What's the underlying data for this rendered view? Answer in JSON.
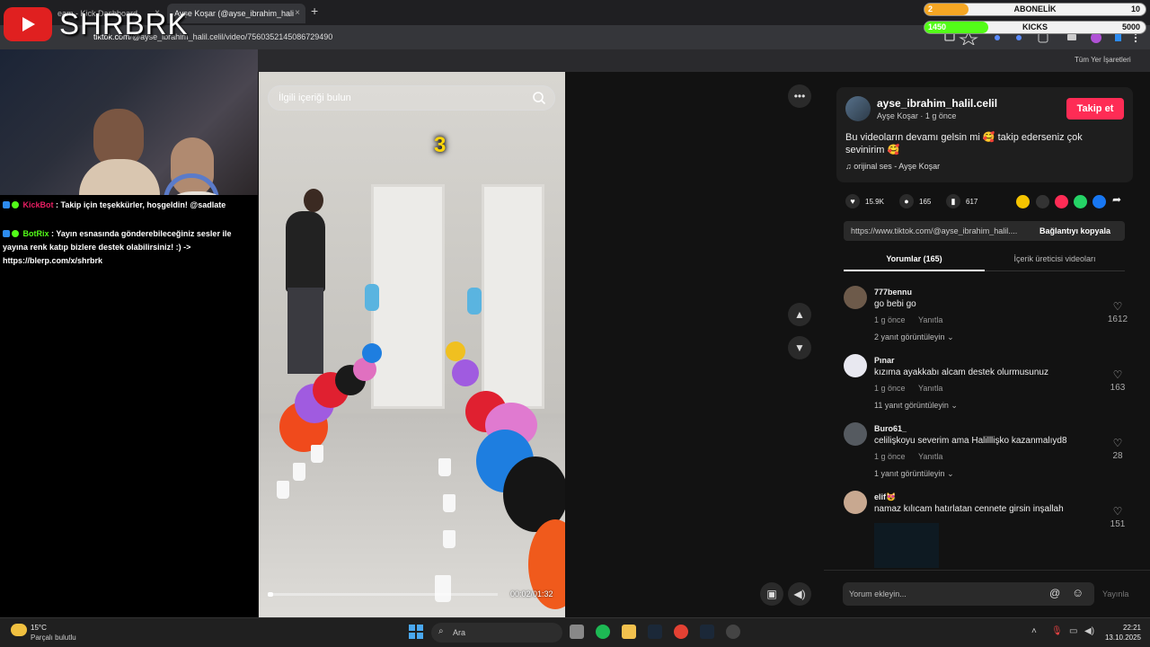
{
  "browser": {
    "tabs": [
      {
        "label": "eam - Kick Dashboard"
      },
      {
        "label": "Ayşe Koşar (@ayse_ibrahim_hali"
      }
    ],
    "close_glyph": "×",
    "new_tab_glyph": "+",
    "url_domain": "tiktok.com",
    "url_path": "/@ayse_ibrahim_halil.celil/video/7560352145086729490",
    "bookmarks_label": "Tüm Yer İşaretleri"
  },
  "overlay": {
    "brand": "SHRBRK",
    "goals": [
      {
        "name": "ABONELİK",
        "current": "2",
        "target": "10",
        "progress": 0.2,
        "color": "#f5a623"
      },
      {
        "name": "KICKS",
        "current": "1450",
        "target": "5000",
        "progress": 0.29,
        "color": "#53fc18"
      }
    ]
  },
  "chat": {
    "messages": [
      {
        "user": "KickBot",
        "text": ": Takip için teşekkürler, hoşgeldin! @sadlate"
      },
      {
        "user": "BotRix",
        "text": ": Yayın esnasında gönderebileceğiniz sesler ile yayına renk katıp bizlere destek olabilirsiniz! :) -> https://blerp.com/x/shrbrk"
      }
    ]
  },
  "video": {
    "search_placeholder": "İlgili içeriği bulun",
    "countdown": "3",
    "timecode": "00:02/01:32",
    "progress": 0.022
  },
  "post": {
    "username": "ayse_ibrahim_halil.celil",
    "author": "Ayşe Koşar",
    "age": "1 g önce",
    "separator": " · ",
    "follow_label": "Takip et",
    "caption": "Bu videoların devamı gelsin mi 🥰 takip ederseniz çok sevinirim 🥰",
    "music": "orijinal ses - Ayşe Koşar",
    "likes": "15.9K",
    "comments": "165",
    "saves": "617",
    "link": "https://www.tiktok.com/@ayse_ibrahim_halil....",
    "copy_label": "Bağlantıyı kopyala",
    "tab_comments": "Yorumlar (165)",
    "tab_creator": "İçerik üreticisi videoları"
  },
  "comments": [
    {
      "user": "777bennu",
      "text": "go bebi go",
      "age": "1 g önce",
      "reply": "Yanıtla",
      "replies": "2 yanıt görüntüleyin",
      "likes": "1612",
      "color": "#6d5a4a"
    },
    {
      "user": "Pınar",
      "text": "kızıma ayakkabı alcam destek olurmusunuz",
      "age": "1 g önce",
      "reply": "Yanıtla",
      "replies": "11 yanıt görüntüleyin",
      "likes": "163",
      "color": "#e8e8f0"
    },
    {
      "user": "Buro61_",
      "text": "celilişkoyu severim ama Halilllişko kazanmalıyd8",
      "age": "1 g önce",
      "reply": "Yanıtla",
      "replies": "1 yanıt görüntüleyin",
      "likes": "28",
      "color": "#555a60"
    },
    {
      "user": "elif😻",
      "text": "namaz kılıcam hatırlatan cennete girsin inşallah",
      "age": "",
      "reply": "",
      "replies": "",
      "likes": "151",
      "color": "#c8a890"
    }
  ],
  "comment_input": {
    "placeholder": "Yorum ekleyin...",
    "post_label": "Yayınla"
  },
  "taskbar": {
    "temperature": "15°C",
    "weather": "Parçalı bulutlu",
    "search_label": "Ara",
    "time": "22:21",
    "date": "13.10.2025"
  }
}
